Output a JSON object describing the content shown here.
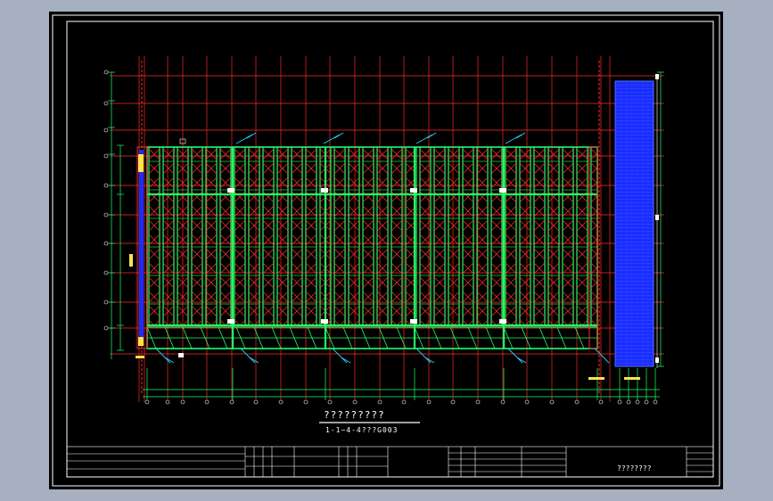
{
  "drawing": {
    "title": "?????????",
    "subtitle": "1-1~4-4???G003"
  },
  "title_block": {
    "drawing_name": "????????"
  },
  "colors": {
    "background": "#000000",
    "frame": "#ffffff",
    "grid_axis": "#ff2a2a",
    "rack_frame": "#22ff66",
    "bracing": "#ff2a2a",
    "side_block": "#1a2cff",
    "dimension": "#ffe34a"
  }
}
